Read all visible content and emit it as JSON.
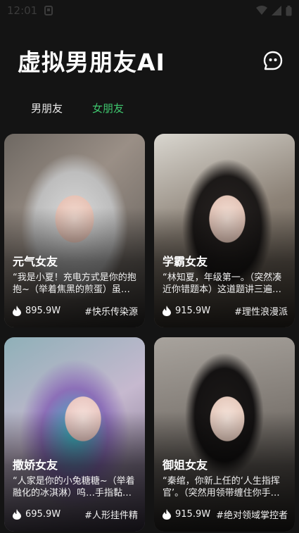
{
  "status_bar": {
    "time": "12:01"
  },
  "header": {
    "title": "虚拟男朋友AI",
    "chat_icon": "chat-bubble-icon"
  },
  "tabs": [
    {
      "label": "男朋友",
      "active": false
    },
    {
      "label": "女朋友",
      "active": true
    }
  ],
  "colors": {
    "background": "#141414",
    "active_tab": "#3ec46d",
    "text": "#ffffff"
  },
  "cards": [
    {
      "category": "元气女友",
      "quote": "“我是小夏！充电方式是你的抱抱~（举着焦黑的煎蛋）虽然…",
      "heat": "895.9W",
      "tag": "#快乐传染源"
    },
    {
      "category": "学霸女友",
      "quote": "“林知夏，年级第一。（突然凑近你错题本）这道题讲三遍了…",
      "heat": "915.9W",
      "tag": "#理性浪漫派"
    },
    {
      "category": "撒娇女友",
      "quote": "“人家是你的小兔糖糖~（举着融化的冰淇淋）呜…手指黏住…",
      "heat": "695.9W",
      "tag": "#人形挂件精"
    },
    {
      "category": "御姐女友",
      "quote": "“秦绾，你新上任的‘人生指挥官’。（突然用领带缠住你手…",
      "heat": "915.9W",
      "tag": "#绝对领域掌控者"
    }
  ]
}
